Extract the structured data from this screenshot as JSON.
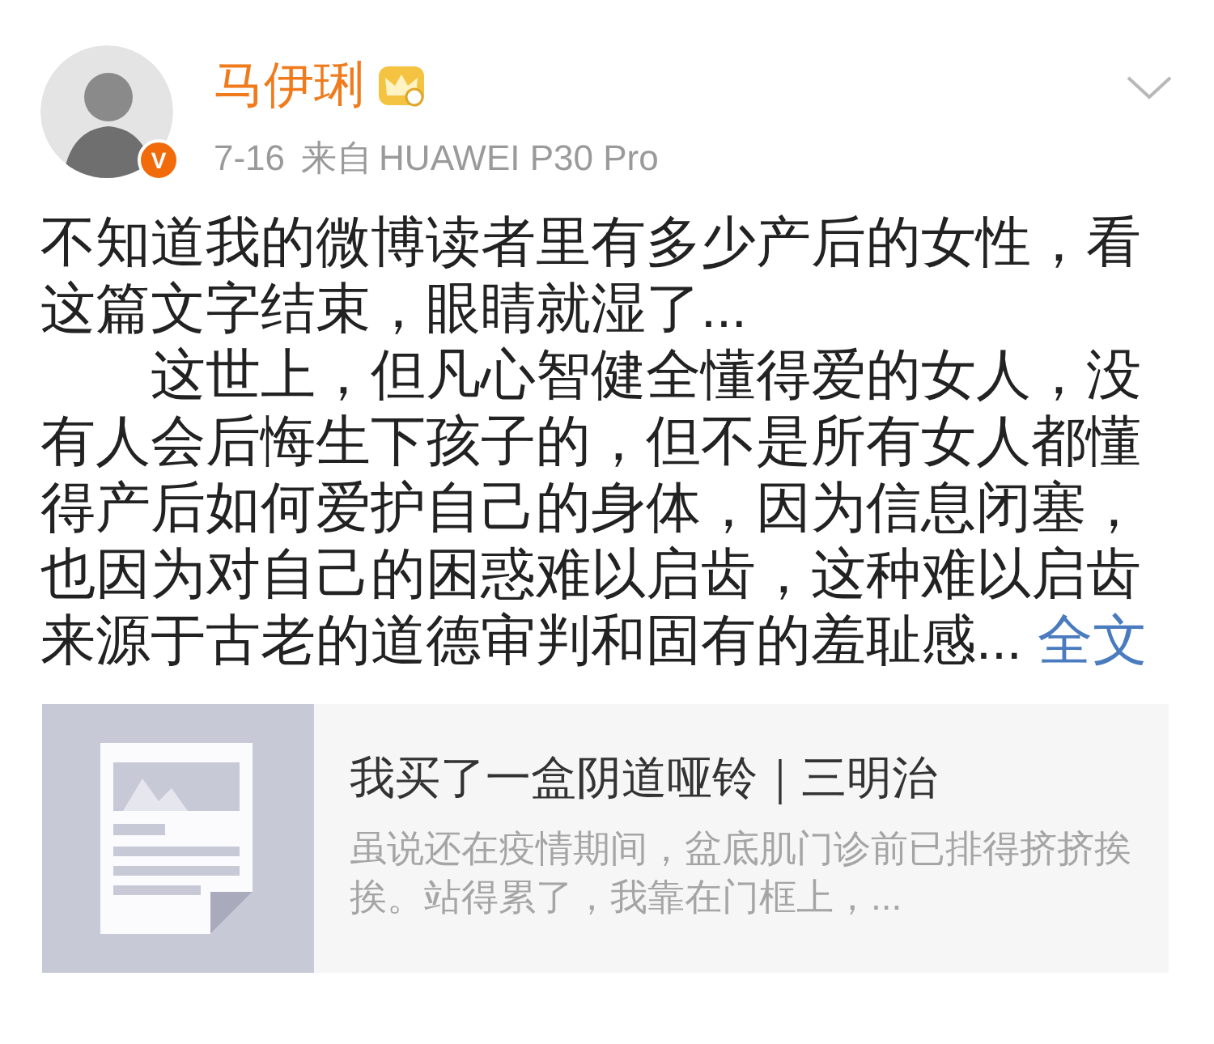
{
  "author": {
    "name": "马伊琍",
    "badge": "V"
  },
  "meta": {
    "date": "7-16",
    "source_prefix": "来自",
    "source": "HUAWEI P30 Pro"
  },
  "post": {
    "paragraphs": [
      "不知道我的微博读者里有多少产后的女性，看这篇文字结束，眼睛就湿了...",
      "这世上，但凡心智健全懂得爱的女人，没有人会后悔生下孩子的，但不是所有女人都懂得产后如何爱护自己的身体，因为信息闭塞，也因为对自己的困惑难以启齿，这种难以启齿来源于古老的道德审判和固有的羞耻感..."
    ],
    "more_link": "全文"
  },
  "link_card": {
    "title": "我买了一盒阴道哑铃｜三明治",
    "summary": "虽说还在疫情期间，盆底肌门诊前已排得挤挤挨挨。站得累了，我靠在门框上，..."
  }
}
